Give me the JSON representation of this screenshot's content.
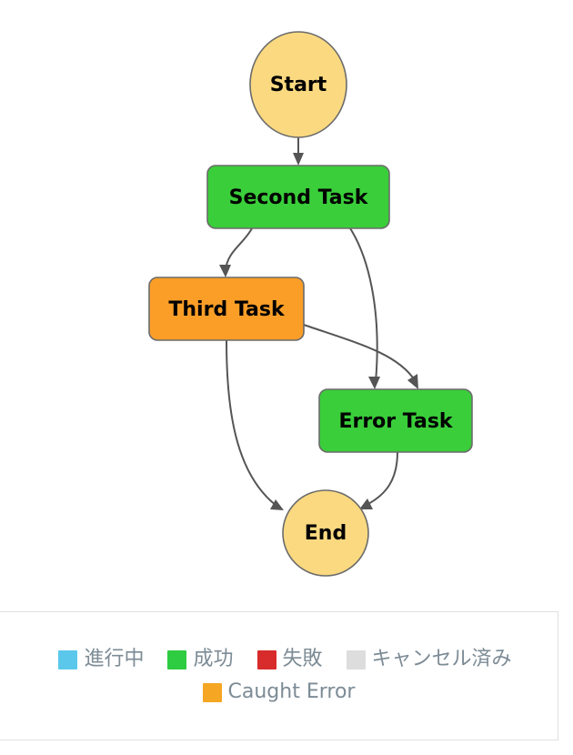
{
  "graph": {
    "nodes": [
      {
        "id": "start",
        "label": "Start",
        "shape": "ellipse",
        "status": "caught_error_pale",
        "color": "#FAD980"
      },
      {
        "id": "second",
        "label": "Second Task",
        "shape": "rect",
        "status": "success",
        "color": "#3ACE3A"
      },
      {
        "id": "third",
        "label": "Third Task",
        "shape": "rect",
        "status": "caught_error",
        "color": "#FB9E28"
      },
      {
        "id": "error",
        "label": "Error Task",
        "shape": "rect",
        "status": "success",
        "color": "#3ACE3A"
      },
      {
        "id": "end",
        "label": "End",
        "shape": "ellipse",
        "status": "caught_error_pale",
        "color": "#FAD980"
      }
    ],
    "edges": [
      {
        "from": "start",
        "to": "second"
      },
      {
        "from": "second",
        "to": "third"
      },
      {
        "from": "second",
        "to": "error"
      },
      {
        "from": "third",
        "to": "error"
      },
      {
        "from": "third",
        "to": "end"
      },
      {
        "from": "error",
        "to": "end"
      }
    ],
    "edge_color": "#555555",
    "node_border_color": "#6b6b6b"
  },
  "legend": {
    "rows": [
      [
        {
          "label": "進行中",
          "color": "#5BC8EB"
        },
        {
          "label": "成功",
          "color": "#2ECC40"
        },
        {
          "label": "失敗",
          "color": "#D82B2B"
        },
        {
          "label": "キャンセル済み",
          "color": "#DDDDDD"
        }
      ],
      [
        {
          "label": "Caught Error",
          "color": "#F5A623"
        }
      ]
    ],
    "text_color": "#7c8b95"
  }
}
